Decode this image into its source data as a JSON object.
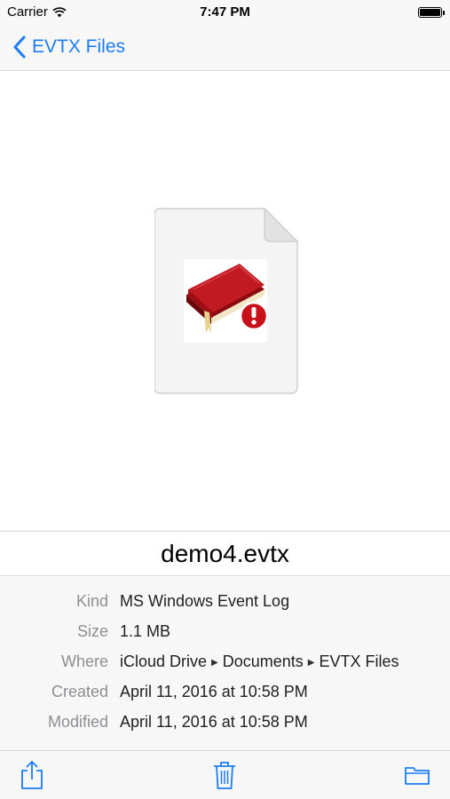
{
  "status_bar": {
    "carrier": "Carrier",
    "time": "7:47 PM"
  },
  "nav": {
    "back_label": "EVTX Files"
  },
  "file": {
    "name": "demo4.evtx"
  },
  "info": [
    {
      "label": "Kind",
      "value": "MS Windows Event Log"
    },
    {
      "label": "Size",
      "value": "1.1 MB"
    },
    {
      "label": "Where",
      "path": [
        "iCloud Drive",
        "Documents",
        "EVTX Files"
      ]
    },
    {
      "label": "Created",
      "value": "April 11, 2016 at 10:58 PM"
    },
    {
      "label": "Modified",
      "value": "April 11, 2016 at 10:58 PM"
    }
  ],
  "icons": {
    "share": "share-icon",
    "trash": "trash-icon",
    "folder": "folder-icon"
  },
  "colors": {
    "accent": "#1b7cf6",
    "book": "#b01218",
    "alert": "#c8101a"
  }
}
